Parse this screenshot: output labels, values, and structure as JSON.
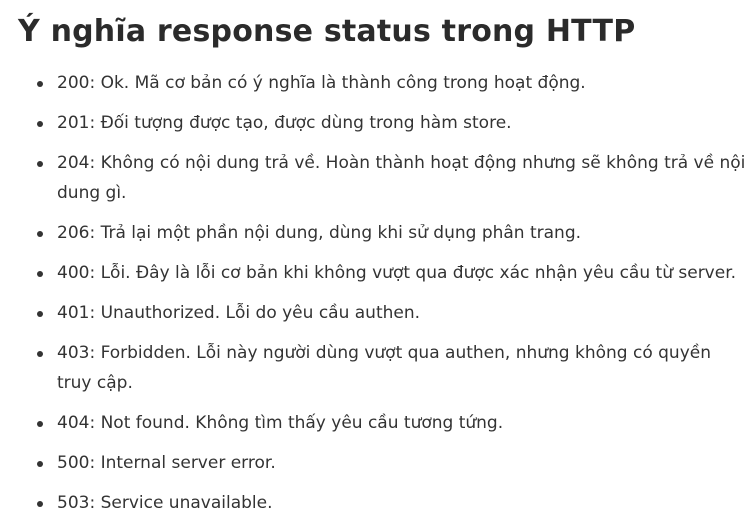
{
  "article": {
    "title": "Ý nghĩa response status trong HTTP",
    "items": [
      "200: Ok. Mã cơ bản có ý nghĩa là thành công trong hoạt động.",
      "201: Đối tượng được tạo, được dùng trong hàm store.",
      "204: Không có nội dung trả về. Hoàn thành hoạt động nhưng sẽ không trả về nội dung gì.",
      "206: Trả lại một phần nội dung, dùng khi sử dụng phân trang.",
      "400: Lỗi. Đây là lỗi cơ bản khi không vượt qua được xác nhận yêu cầu từ server.",
      "401: Unauthorized. Lỗi do yêu cầu authen.",
      "403: Forbidden. Lỗi này người dùng vượt qua authen, nhưng không có quyền truy cập.",
      "404: Not found. Không tìm thấy yêu cầu tương tứng.",
      "500: Internal server error.",
      "503: Service unavailable."
    ]
  }
}
